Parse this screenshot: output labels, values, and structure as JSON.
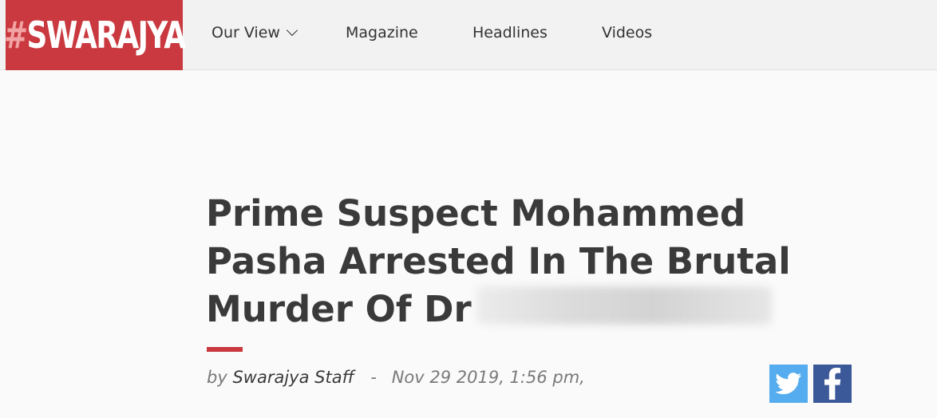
{
  "header": {
    "logo_hash": "#",
    "logo_text": "SWARAJYA",
    "nav": [
      {
        "label": "Our View"
      },
      {
        "label": "Magazine"
      },
      {
        "label": "Headlines"
      },
      {
        "label": "Videos"
      }
    ]
  },
  "article": {
    "title_main": "Prime Suspect Mohammed Pasha Arrested In The Brutal Murder Of Dr",
    "by": "by",
    "author": "Swarajya Staff",
    "separator": "-",
    "date": "Nov 29 2019, 1:56 pm,"
  },
  "icons": {
    "twitter": "twitter-icon",
    "facebook": "facebook-icon",
    "dropdown": "chevron-down-icon"
  },
  "colors": {
    "brand": "#c9393f",
    "twitter": "#55acee",
    "facebook": "#3b5998"
  }
}
